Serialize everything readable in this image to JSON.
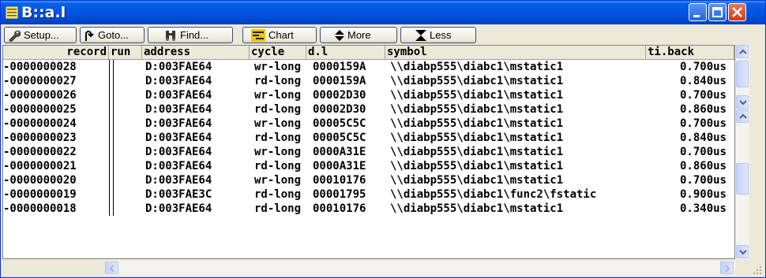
{
  "window": {
    "title": "B::a.l"
  },
  "toolbar": {
    "setup": "Setup...",
    "goto": "Goto...",
    "find": "Find...",
    "chart": "Chart",
    "more": "More",
    "less": "Less"
  },
  "columns": {
    "record": "record",
    "run": "run",
    "address": "address",
    "cycle": "cycle",
    "data": "d.l",
    "symbol": "symbol",
    "tiback": "ti.back"
  },
  "rows": [
    {
      "record": "-0000000028",
      "address": "D:003FAE64",
      "cycle": "wr-long",
      "data": "0000159A",
      "symbol": "\\\\diabp555\\diabc1\\mstatic1",
      "tiback": "0.700us"
    },
    {
      "record": "-0000000027",
      "address": "D:003FAE64",
      "cycle": "rd-long",
      "data": "0000159A",
      "symbol": "\\\\diabp555\\diabc1\\mstatic1",
      "tiback": "0.840us"
    },
    {
      "record": "-0000000026",
      "address": "D:003FAE64",
      "cycle": "wr-long",
      "data": "00002D30",
      "symbol": "\\\\diabp555\\diabc1\\mstatic1",
      "tiback": "0.700us"
    },
    {
      "record": "-0000000025",
      "address": "D:003FAE64",
      "cycle": "rd-long",
      "data": "00002D30",
      "symbol": "\\\\diabp555\\diabc1\\mstatic1",
      "tiback": "0.860us"
    },
    {
      "record": "-0000000024",
      "address": "D:003FAE64",
      "cycle": "wr-long",
      "data": "00005C5C",
      "symbol": "\\\\diabp555\\diabc1\\mstatic1",
      "tiback": "0.700us"
    },
    {
      "record": "-0000000023",
      "address": "D:003FAE64",
      "cycle": "rd-long",
      "data": "00005C5C",
      "symbol": "\\\\diabp555\\diabc1\\mstatic1",
      "tiback": "0.840us"
    },
    {
      "record": "-0000000022",
      "address": "D:003FAE64",
      "cycle": "wr-long",
      "data": "0000A31E",
      "symbol": "\\\\diabp555\\diabc1\\mstatic1",
      "tiback": "0.700us"
    },
    {
      "record": "-0000000021",
      "address": "D:003FAE64",
      "cycle": "rd-long",
      "data": "0000A31E",
      "symbol": "\\\\diabp555\\diabc1\\mstatic1",
      "tiback": "0.860us"
    },
    {
      "record": "-0000000020",
      "address": "D:003FAE64",
      "cycle": "wr-long",
      "data": "00010176",
      "symbol": "\\\\diabp555\\diabc1\\mstatic1",
      "tiback": "0.700us"
    },
    {
      "record": "-0000000019",
      "address": "D:003FAE3C",
      "cycle": "rd-long",
      "data": "00001795",
      "symbol": "\\\\diabp555\\diabc1\\func2\\fstatic",
      "tiback": "0.900us"
    },
    {
      "record": "-0000000018",
      "address": "D:003FAE64",
      "cycle": "rd-long",
      "data": "00010176",
      "symbol": "\\\\diabp555\\diabc1\\mstatic1",
      "tiback": "0.340us"
    }
  ],
  "icons": {
    "app": "trace-window-icon",
    "setup": "wrench-icon",
    "goto": "goto-arrow-icon",
    "find": "binoculars-icon",
    "chart": "chart-icon",
    "more": "up-down-arrows-icon",
    "less": "hourglass-icon"
  },
  "colors": {
    "titlebar": "#0054e3",
    "close": "#c93d1f",
    "chart_icon": "#d4a000"
  }
}
